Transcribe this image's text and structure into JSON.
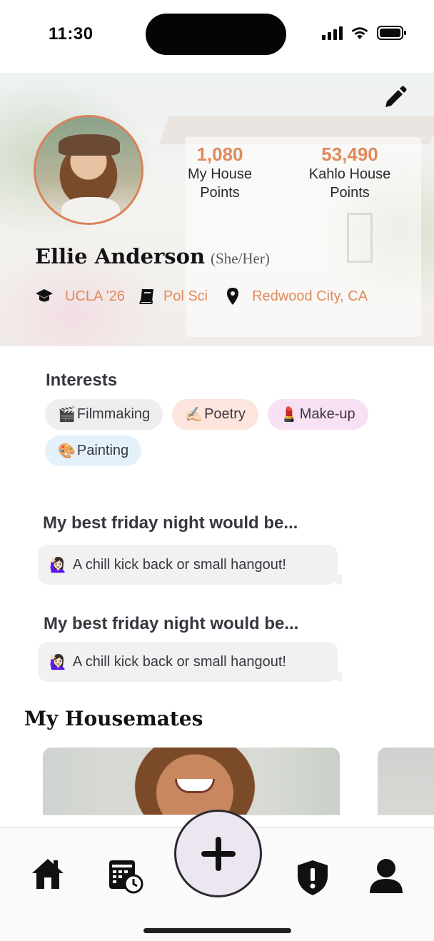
{
  "status_bar": {
    "time": "11:30",
    "icons": [
      "cellular-signal-icon",
      "wifi-icon",
      "battery-icon"
    ]
  },
  "profile": {
    "edit_icon": "pencil-icon",
    "avatar": "profile-photo",
    "my_points": {
      "value": "1,080",
      "label": "My House Points"
    },
    "house_points": {
      "value": "53,490",
      "label": "Kahlo House Points"
    },
    "name": "Ellie Anderson",
    "pronouns": "(She/Her)",
    "school": {
      "icon": "graduation-cap-icon",
      "text": "UCLA '26"
    },
    "major": {
      "icon": "book-icon",
      "text": "Pol Sci"
    },
    "location": {
      "icon": "location-pin-icon",
      "text": "Redwood City, CA"
    },
    "accent_color": "#e08a5b"
  },
  "interests": {
    "title": "Interests",
    "items": [
      {
        "emoji": "🎬",
        "label": "Filmmaking",
        "color": "#eeeeee"
      },
      {
        "emoji": "✍🏻",
        "label": "Poetry",
        "color": "#fbe5dc"
      },
      {
        "emoji": "💄",
        "label": "Make-up",
        "color": "#f8e1f2"
      },
      {
        "emoji": "🎨",
        "label": "Painting",
        "color": "#e4f1fb"
      }
    ]
  },
  "prompts": [
    {
      "question": "My best friday night would be...",
      "emoji": "🙋🏻‍♀️",
      "answer": "A chill kick back or small hangout!"
    },
    {
      "question": "My best friday night would be...",
      "emoji": "🙋🏻‍♀️",
      "answer": "A chill kick back or small hangout!"
    }
  ],
  "housemates": {
    "title": "My Housemates"
  },
  "tab_bar": {
    "items": [
      "home-icon",
      "calendar-clock-icon",
      "add-icon",
      "shield-alert-icon",
      "user-icon"
    ]
  }
}
